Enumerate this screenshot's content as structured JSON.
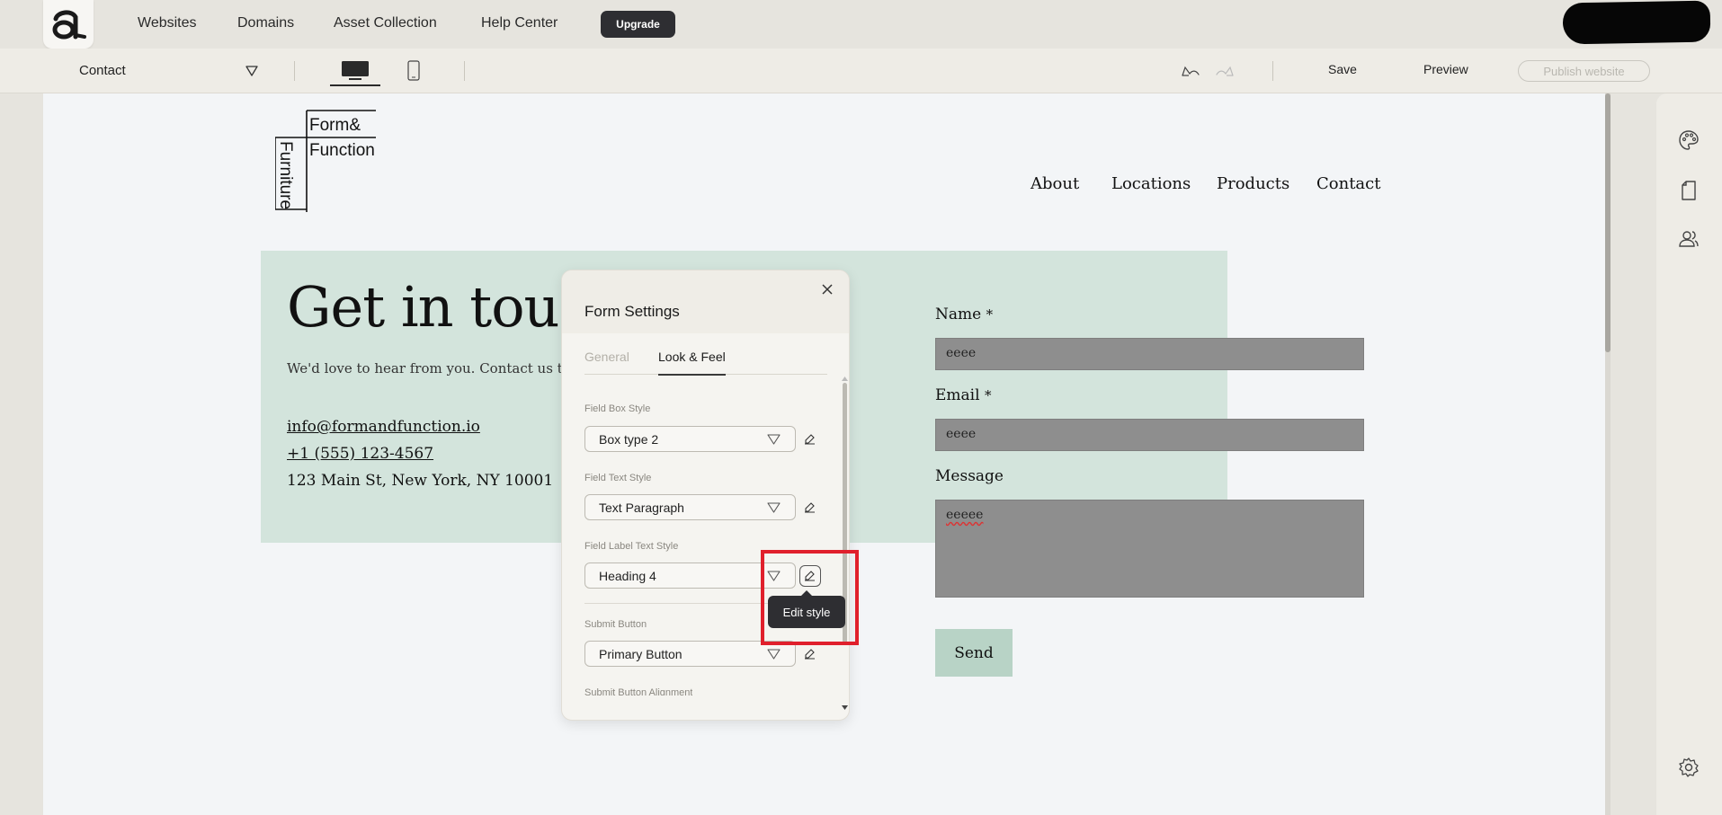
{
  "topnav": {
    "items": [
      "Websites",
      "Domains",
      "Asset Collection",
      "Help Center"
    ],
    "upgrade_label": "Upgrade"
  },
  "toolbar": {
    "current_page": "Contact",
    "save_label": "Save",
    "preview_label": "Preview",
    "publish_label": "Publish website"
  },
  "site": {
    "brand": {
      "line1": "Form&",
      "line2": "Function",
      "vertical": "Furniture"
    },
    "nav": [
      "About",
      "Locations",
      "Products",
      "Contact"
    ],
    "hero": {
      "title": "Get in touch",
      "subtitle": "We'd love to hear from you. Contact us today",
      "email": "info@formandfunction.io",
      "phone": "+1 (555) 123-4567",
      "address": "123 Main St, New York, NY 10001"
    },
    "form": {
      "name_label": "Name",
      "email_label": "Email",
      "message_label": "Message",
      "required_mark": "*",
      "name_value": "eeee",
      "email_value": "eeee",
      "message_value": "eeeee",
      "send_label": "Send"
    }
  },
  "form_settings": {
    "title": "Form Settings",
    "tabs": [
      {
        "label": "General",
        "active": false
      },
      {
        "label": "Look & Feel",
        "active": true
      }
    ],
    "fields": [
      {
        "caption": "Field Box Style",
        "value": "Box type 2"
      },
      {
        "caption": "Field Text Style",
        "value": "Text Paragraph"
      },
      {
        "caption": "Field Label Text Style",
        "value": "Heading 4"
      },
      {
        "caption": "Submit Button",
        "value": "Primary Button"
      },
      {
        "caption": "Submit Button Alignment",
        "value": ""
      }
    ],
    "tooltip": "Edit style"
  },
  "colors": {
    "hero_bg": "#d3e4dc",
    "field_bg": "#8e8e8e",
    "send_bg": "#b8d3c6",
    "highlight": "#e0202c",
    "dark_button": "#2e2e32"
  },
  "icons": {
    "sidebar": [
      "palette-icon",
      "page-icon",
      "users-icon",
      "gear-icon"
    ]
  }
}
